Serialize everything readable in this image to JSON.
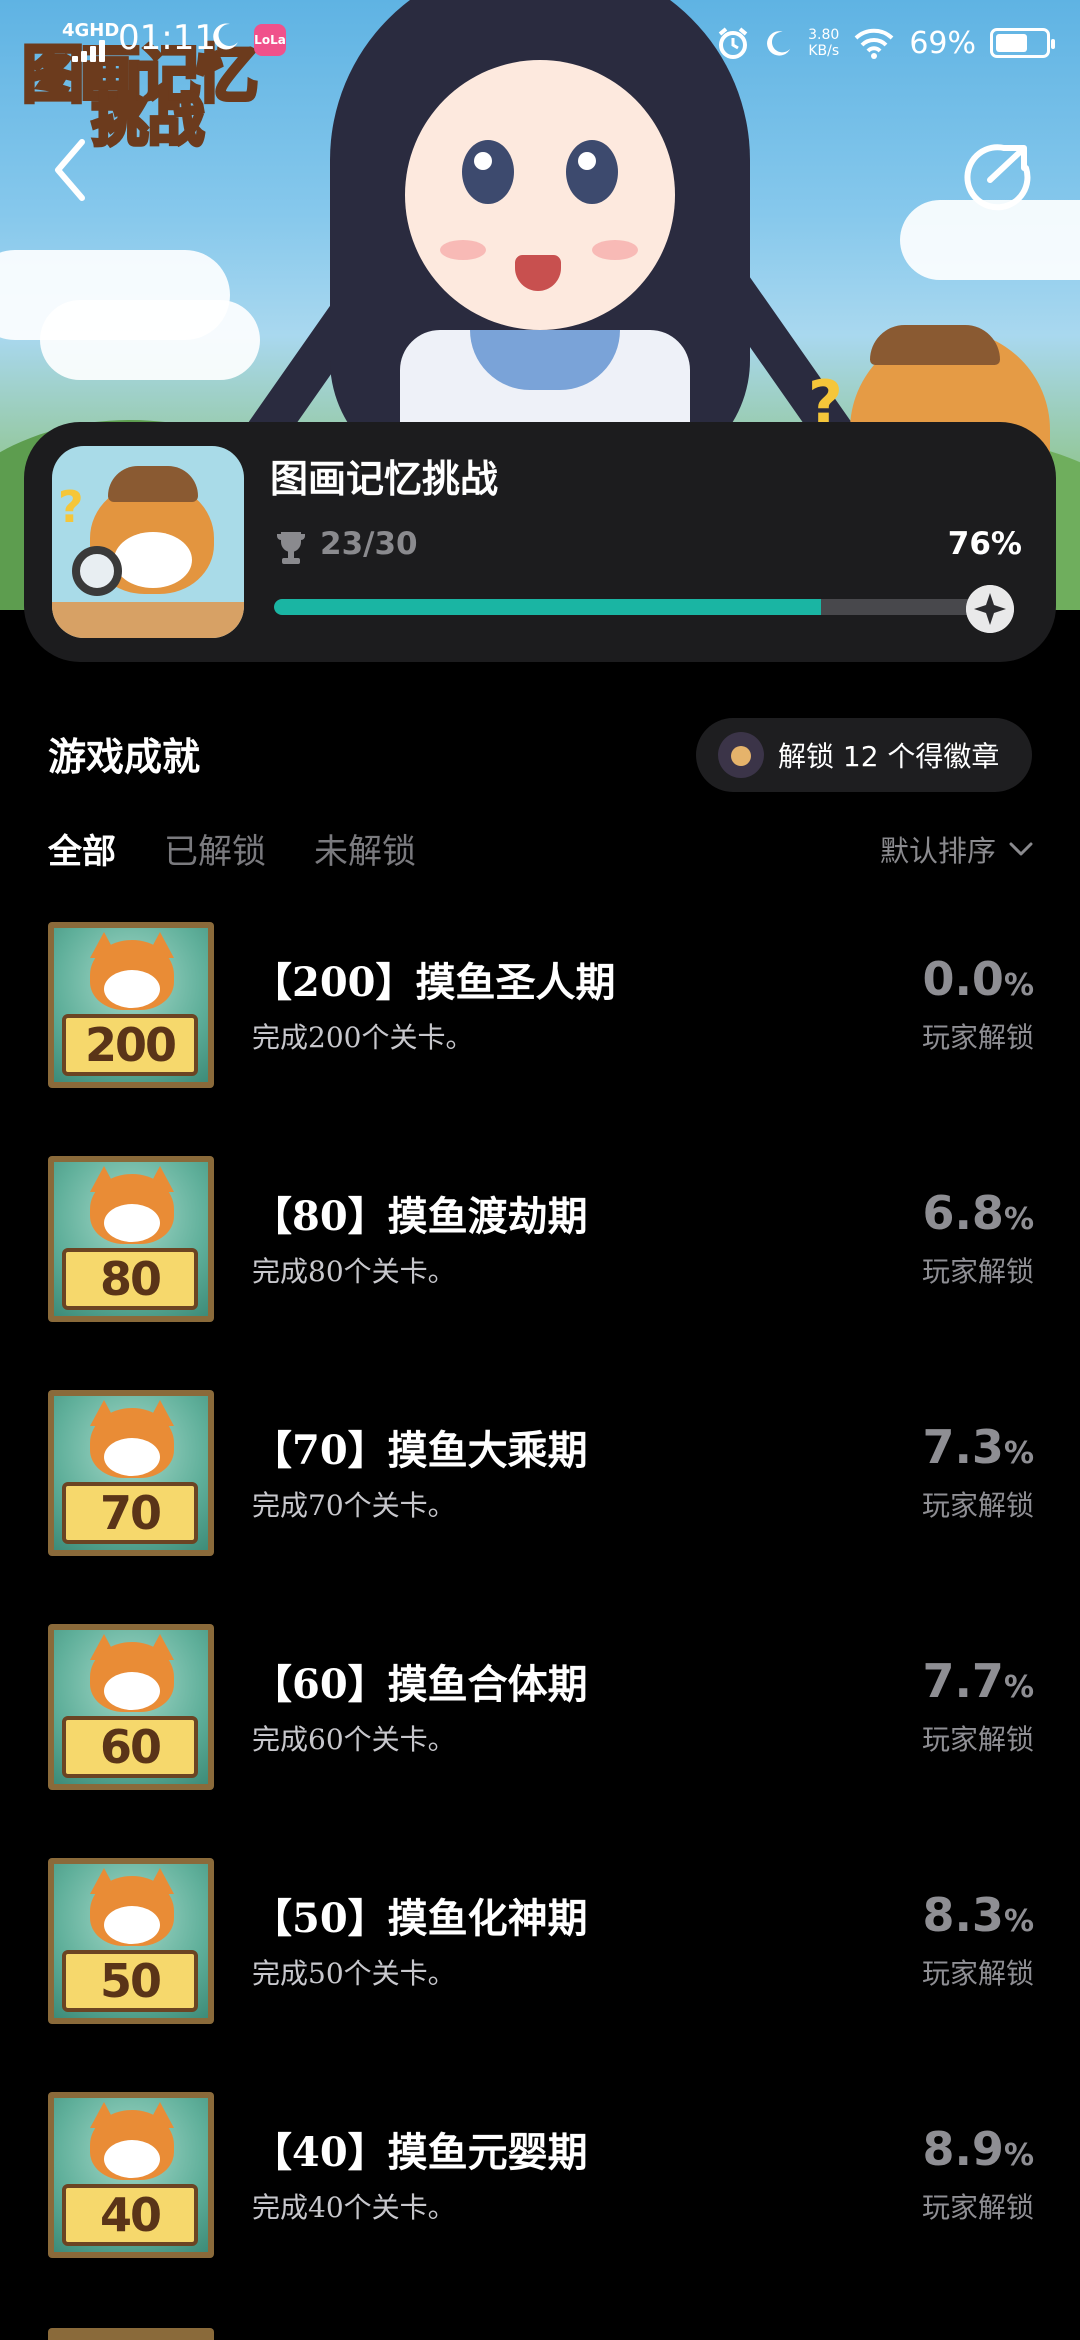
{
  "status_bar": {
    "network": "4GHD",
    "time": "01:11",
    "app_badge": "LoLa",
    "speed": "3.80",
    "speed_unit": "KB/s",
    "battery_percent": "69%",
    "battery_level": 0.69
  },
  "banner": {
    "logo_line1": "图画记忆",
    "logo_line2": "挑战"
  },
  "game": {
    "title": "图画记忆挑战",
    "progress_text": "23/30",
    "progress_percent": "76%",
    "progress_value": 0.76,
    "accent_color": "#1ab5a3"
  },
  "section": {
    "title": "游戏成就",
    "badge_text": "解锁 12 个得徽章"
  },
  "tabs": [
    {
      "label": "全部",
      "active": true
    },
    {
      "label": "已解锁",
      "active": false
    },
    {
      "label": "未解锁",
      "active": false
    }
  ],
  "sort_label": "默认排序",
  "achievements": [
    {
      "badge_number": "200",
      "name": "【200】摸鱼圣人期",
      "desc": "完成200个关卡。",
      "pct_value": "0.0",
      "pct_unit": "%",
      "pct_label": "玩家解锁"
    },
    {
      "badge_number": "80",
      "name": "【80】摸鱼渡劫期",
      "desc": "完成80个关卡。",
      "pct_value": "6.8",
      "pct_unit": "%",
      "pct_label": "玩家解锁"
    },
    {
      "badge_number": "70",
      "name": "【70】摸鱼大乘期",
      "desc": "完成70个关卡。",
      "pct_value": "7.3",
      "pct_unit": "%",
      "pct_label": "玩家解锁"
    },
    {
      "badge_number": "60",
      "name": "【60】摸鱼合体期",
      "desc": "完成60个关卡。",
      "pct_value": "7.7",
      "pct_unit": "%",
      "pct_label": "玩家解锁"
    },
    {
      "badge_number": "50",
      "name": "【50】摸鱼化神期",
      "desc": "完成50个关卡。",
      "pct_value": "8.3",
      "pct_unit": "%",
      "pct_label": "玩家解锁"
    },
    {
      "badge_number": "40",
      "name": "【40】摸鱼元婴期",
      "desc": "完成40个关卡。",
      "pct_value": "8.9",
      "pct_unit": "%",
      "pct_label": "玩家解锁"
    }
  ]
}
